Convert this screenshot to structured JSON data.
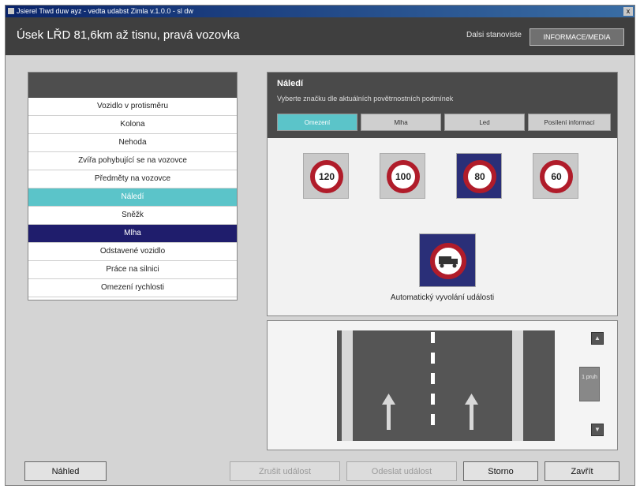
{
  "window": {
    "title": "Jsierel Tiwd duw ayz - vedta udabst Zimla v.1.0.0 - sl dw",
    "close_label": "x"
  },
  "header": {
    "title": "Úsek LŘD 81,6km až tisnu, pravá vozovka",
    "user": "Dalsi stanoviste",
    "user_button": "INFORMACE/MEDIA"
  },
  "nav": {
    "items": [
      {
        "label": "Vozidlo v protisměru"
      },
      {
        "label": "Kolona"
      },
      {
        "label": "Nehoda"
      },
      {
        "label": "Zvířa pohybující se na vozovce"
      },
      {
        "label": "Předměty na vozovce"
      },
      {
        "label": "Náledí"
      },
      {
        "label": "Sněžk"
      },
      {
        "label": "Mlha"
      },
      {
        "label": "Odstavené vozidlo"
      },
      {
        "label": "Práce na silnici"
      },
      {
        "label": "Omezení rychlosti"
      }
    ],
    "highlighted_index": 5,
    "selected_index": 7
  },
  "detail": {
    "title": "Náledí",
    "subtitle": "Vyberte značku dle aktuálních povětrnostních podmínek",
    "tabs": [
      "Omezení",
      "Mlha",
      "Led",
      "Posílení informací"
    ],
    "active_tab": 0,
    "signs": [
      {
        "value": "120",
        "selected": false
      },
      {
        "value": "100",
        "selected": false
      },
      {
        "value": "80",
        "selected": true
      },
      {
        "value": "60",
        "selected": false
      }
    ],
    "truck_sign_icon": "no-trucks-sign-icon",
    "caption": "Automatický vyvolání události"
  },
  "road": {
    "lane_label": "1 pruh",
    "up_icon": "up-arrow-icon",
    "down_icon": "down-arrow-icon"
  },
  "buttons": {
    "preview": "Náhled",
    "cancel_event": "Zrušit událost",
    "send_event": "Odeslat událost",
    "storno": "Storno",
    "close": "Zavřít"
  },
  "colors": {
    "header_bg": "#3f3f3f",
    "accent": "#5bc4c9",
    "selected": "#1f1d6c",
    "sign_red": "#b01c2a"
  }
}
